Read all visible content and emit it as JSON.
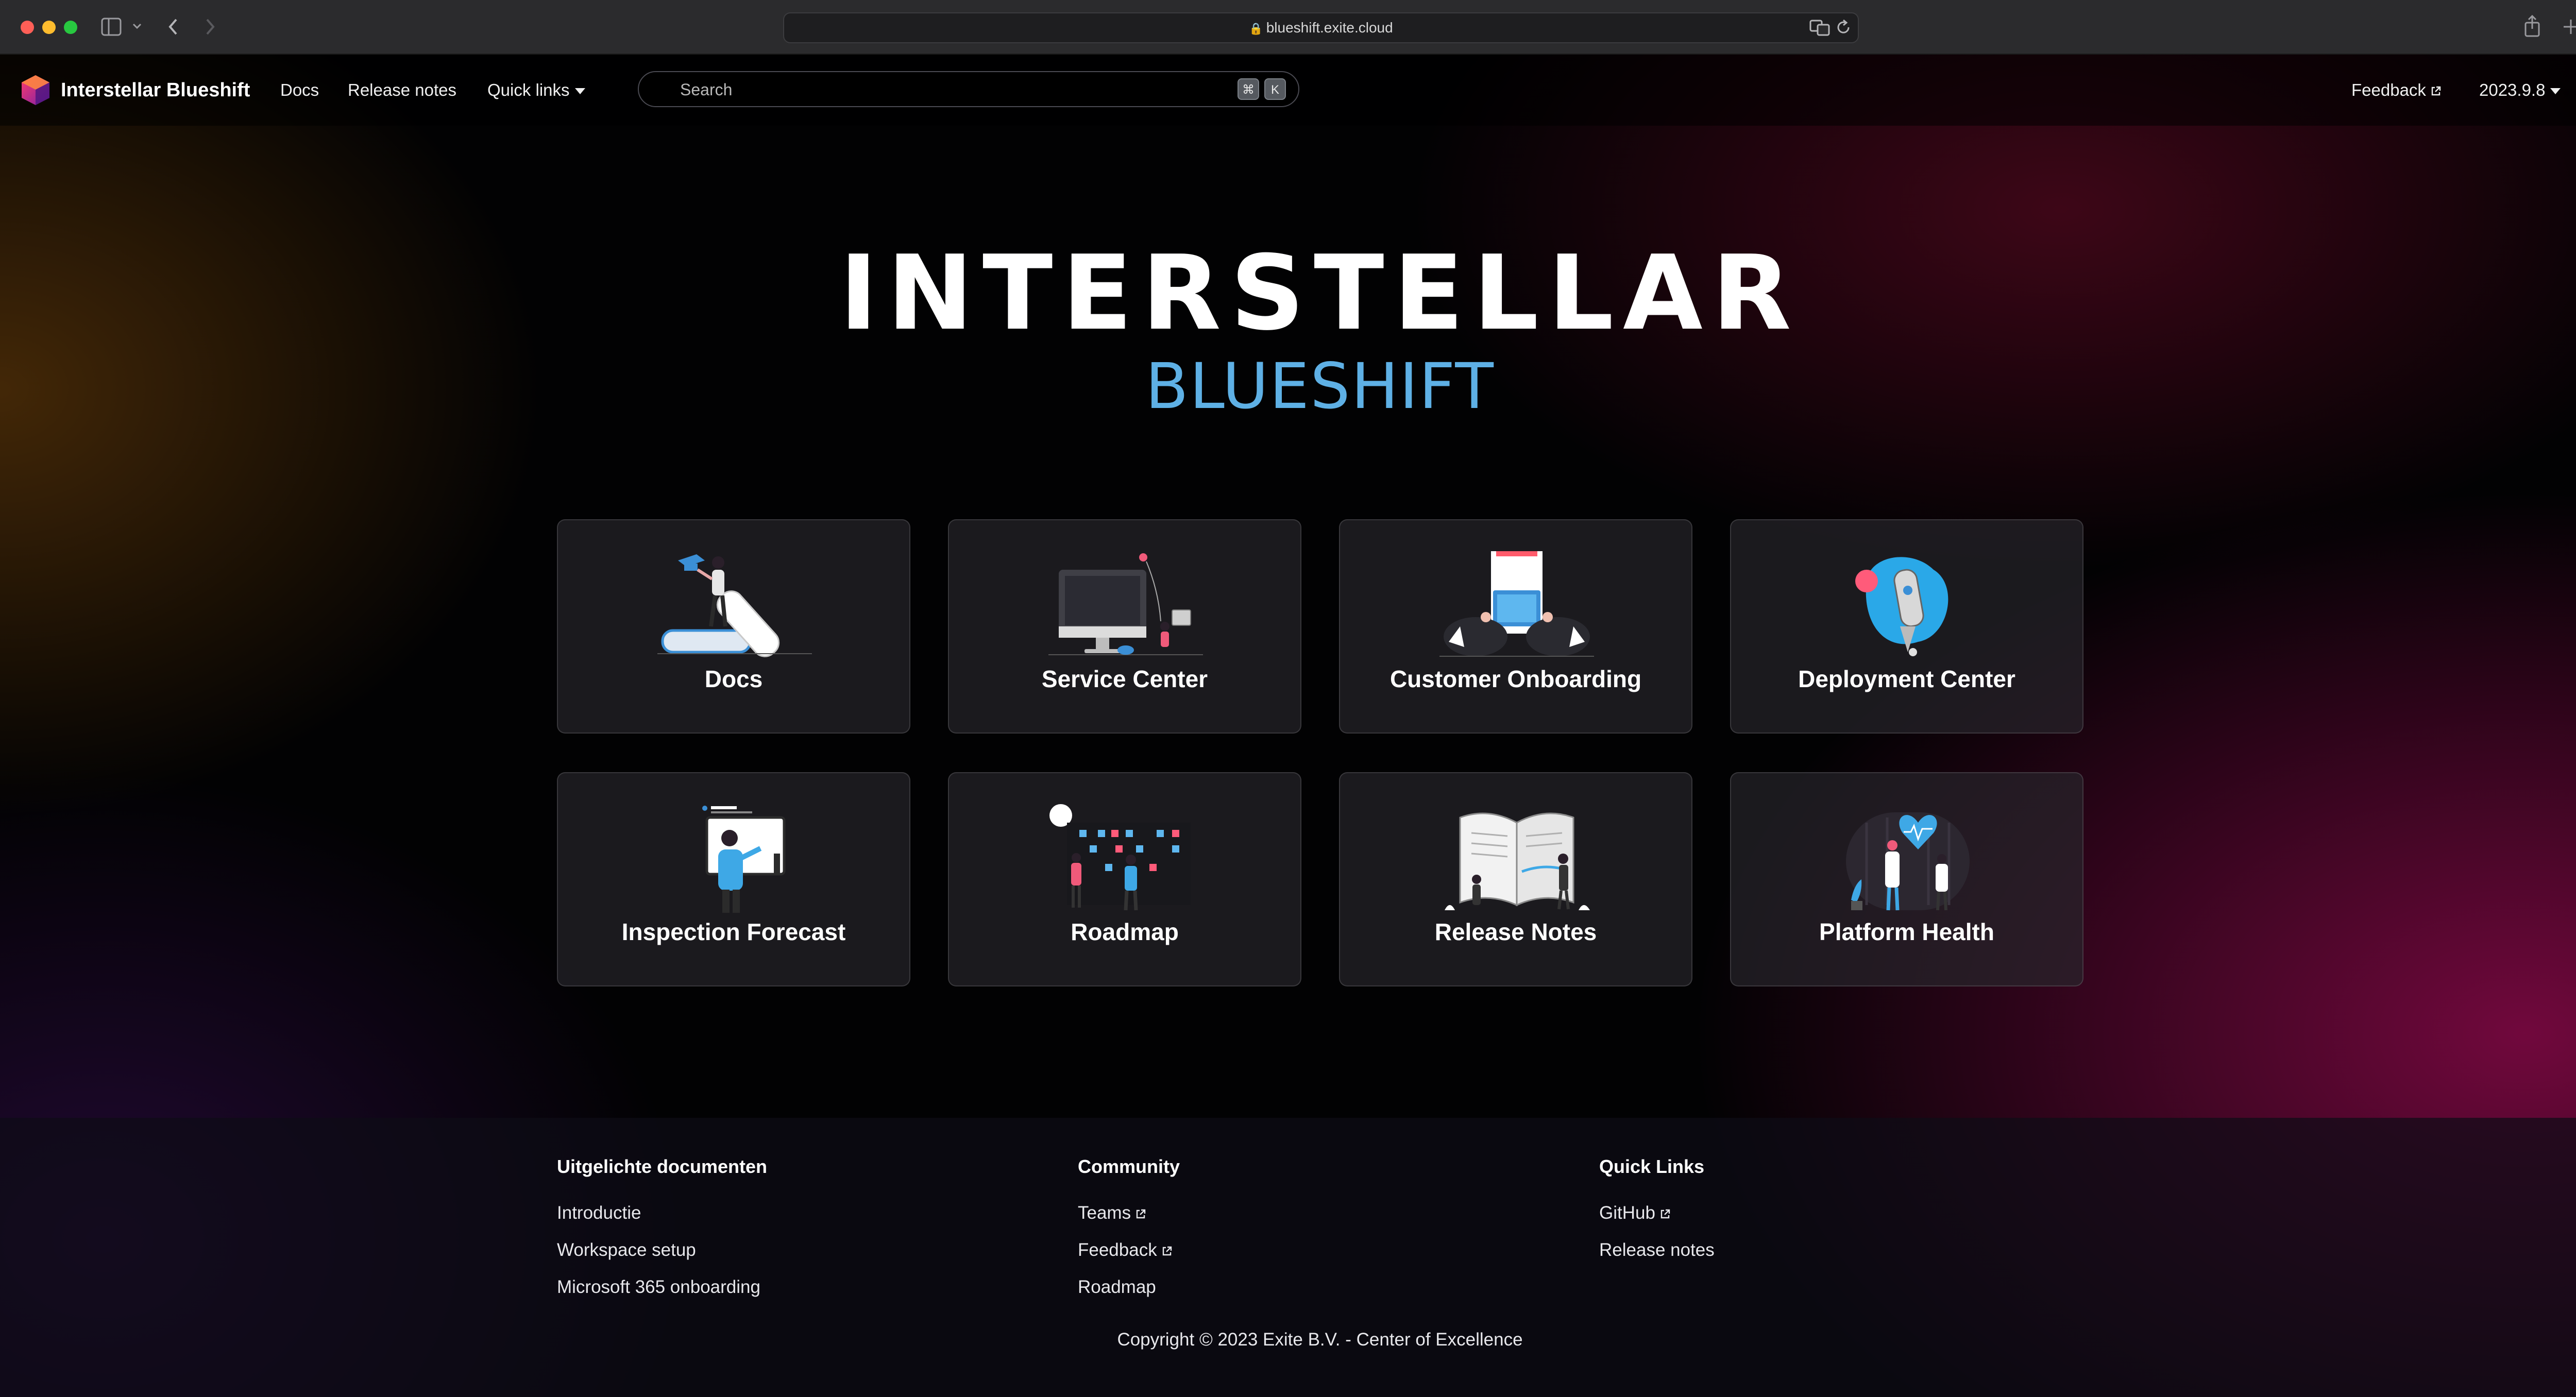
{
  "browser": {
    "url": "blueshift.exite.cloud"
  },
  "navbar": {
    "brand": "Interstellar Blueshift",
    "links": [
      "Docs",
      "Release notes",
      "Quick links"
    ],
    "search_placeholder": "Search",
    "search_keys": [
      "⌘",
      "K"
    ],
    "feedback": "Feedback",
    "version": "2023.9.8"
  },
  "hero": {
    "title": "INTERSTELLAR",
    "subtitle": "BLUESHIFT"
  },
  "cards": [
    {
      "label": "Docs",
      "icon": "books-illustration-icon"
    },
    {
      "label": "Service Center",
      "icon": "computer-service-illustration-icon"
    },
    {
      "label": "Customer Onboarding",
      "icon": "onboarding-laptop-illustration-icon"
    },
    {
      "label": "Deployment Center",
      "icon": "rocket-illustration-icon"
    },
    {
      "label": "Inspection Forecast",
      "icon": "whiteboard-illustration-icon"
    },
    {
      "label": "Roadmap",
      "icon": "roadmap-board-illustration-icon"
    },
    {
      "label": "Release Notes",
      "icon": "open-book-illustration-icon"
    },
    {
      "label": "Platform Health",
      "icon": "health-heart-illustration-icon"
    }
  ],
  "footer": {
    "columns": [
      {
        "title": "Uitgelichte documenten",
        "links": [
          "Introductie",
          "Workspace setup",
          "Microsoft 365 onboarding"
        ]
      },
      {
        "title": "Community",
        "links": [
          "Teams",
          "Feedback",
          "Roadmap"
        ]
      },
      {
        "title": "Quick Links",
        "links": [
          "GitHub",
          "Release notes"
        ]
      }
    ],
    "copyright": "Copyright © 2023 Exite B.V. - Center of Excellence"
  },
  "colors": {
    "accent_blue": "#5eb0e5",
    "card_background": "#28262c",
    "page_background": "#020203"
  }
}
